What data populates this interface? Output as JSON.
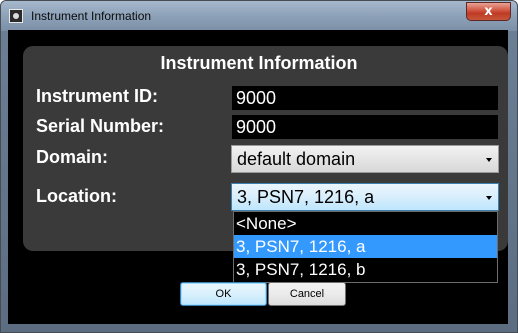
{
  "window": {
    "title": "Instrument Information",
    "close_glyph": "x"
  },
  "dialog": {
    "heading": "Instrument Information",
    "fields": {
      "instrument_id": {
        "label": "Instrument ID:",
        "value": "9000"
      },
      "serial_number": {
        "label": "Serial Number:",
        "value": "9000"
      },
      "domain": {
        "label": "Domain:",
        "value": "default domain"
      },
      "location": {
        "label": "Location:",
        "value": "3, PSN7, 1216, a",
        "options": [
          "<None>",
          "3, PSN7, 1216, a",
          "3, PSN7, 1216, b"
        ],
        "selected_index": 1
      }
    },
    "buttons": {
      "ok": "OK",
      "cancel": "Cancel"
    }
  },
  "colors": {
    "selection": "#3399ff",
    "panel": "#3a3a3a",
    "close_button": "#c8563a"
  },
  "icons": {
    "app": "gear-icon",
    "close": "close-icon",
    "dropdown": "chevron-down-icon"
  }
}
